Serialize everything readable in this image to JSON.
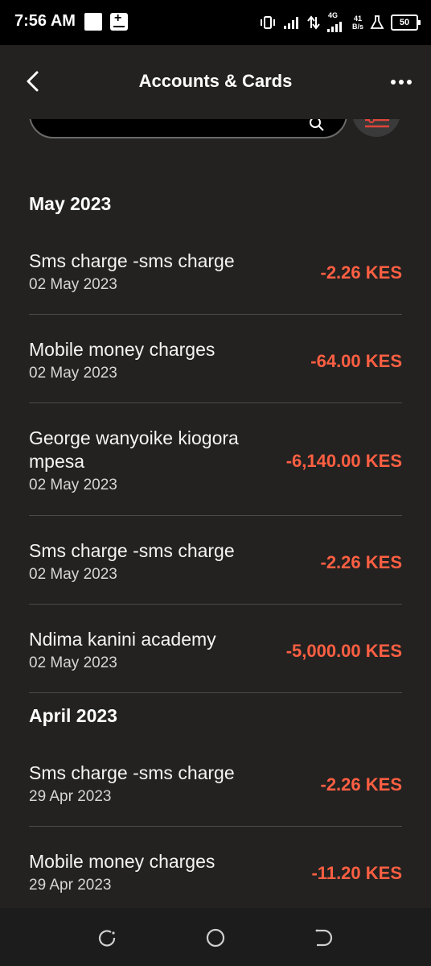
{
  "status_bar": {
    "time": "7:56 AM",
    "network_type": "4G",
    "speed_value": "41",
    "speed_unit": "B/s",
    "battery": "50"
  },
  "header": {
    "title": "Accounts & Cards"
  },
  "groups": [
    {
      "month": "May 2023",
      "transactions": [
        {
          "name": "Sms charge -sms charge",
          "date": "02 May 2023",
          "amount": "-2.26 KES"
        },
        {
          "name": "Mobile money charges",
          "date": "02 May 2023",
          "amount": "-64.00 KES"
        },
        {
          "name": "George wanyoike kiogora mpesa",
          "date": "02 May 2023",
          "amount": "-6,140.00 KES"
        },
        {
          "name": "Sms charge -sms charge",
          "date": "02 May 2023",
          "amount": "-2.26 KES"
        },
        {
          "name": "Ndima kanini academy",
          "date": "02 May 2023",
          "amount": "-5,000.00 KES"
        }
      ]
    },
    {
      "month": "April 2023",
      "transactions": [
        {
          "name": "Sms charge -sms charge",
          "date": "29 Apr 2023",
          "amount": "-2.26 KES"
        },
        {
          "name": "Mobile money charges",
          "date": "29 Apr 2023",
          "amount": "-11.20 KES"
        }
      ]
    }
  ],
  "colors": {
    "background": "#232221",
    "debit_amount": "#ff5f42",
    "divider": "#4a4a4a"
  }
}
